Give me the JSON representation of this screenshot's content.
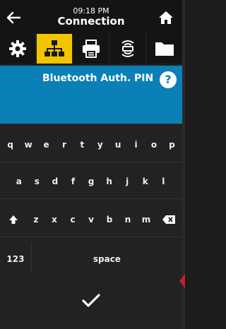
{
  "header": {
    "time": "09:18 PM",
    "title": "Connection"
  },
  "tabs": [
    {
      "name": "settings",
      "icon": "gear-icon",
      "active": false
    },
    {
      "name": "connection",
      "icon": "network-icon",
      "active": true
    },
    {
      "name": "print",
      "icon": "printer-icon",
      "active": false
    },
    {
      "name": "rfid",
      "icon": "rfid-icon",
      "active": false
    },
    {
      "name": "storage",
      "icon": "folder-icon",
      "active": false
    }
  ],
  "banner": {
    "title": "Bluetooth Auth. PIN",
    "help_label": "?"
  },
  "keyboard": {
    "row1": [
      "q",
      "w",
      "e",
      "r",
      "t",
      "y",
      "u",
      "i",
      "o",
      "p"
    ],
    "row2": [
      "a",
      "s",
      "d",
      "f",
      "g",
      "h",
      "j",
      "k",
      "l"
    ],
    "row3": [
      "z",
      "x",
      "c",
      "v",
      "b",
      "n",
      "m"
    ],
    "numbers_label": "123",
    "space_label": "space"
  },
  "colors": {
    "accent": "#f3c400",
    "banner": "#0a80b7",
    "background": "#1f1f1f"
  }
}
